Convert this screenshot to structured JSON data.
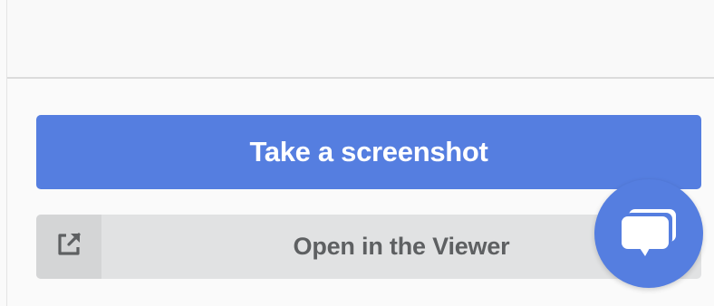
{
  "actions": {
    "screenshot_label": "Take a screenshot",
    "viewer_label": "Open in the Viewer"
  },
  "icons": {
    "viewer": "external-link-icon",
    "chat": "chat-icon"
  },
  "colors": {
    "primary": "#557ee0",
    "secondary_bg": "#e1e2e3",
    "secondary_text": "#5e6062"
  }
}
